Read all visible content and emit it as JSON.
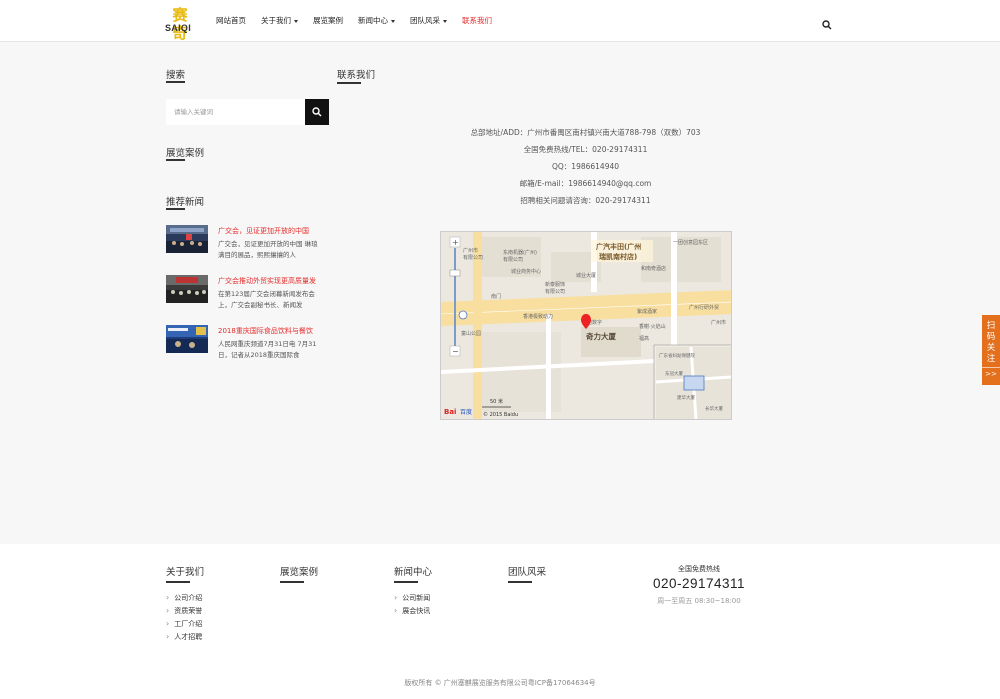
{
  "header": {
    "logo_mark": "赛奇",
    "logo_text": "SAIQI",
    "nav": [
      {
        "label": "网站首页",
        "dropdown": false,
        "active": false
      },
      {
        "label": "关于我们",
        "dropdown": true,
        "active": false
      },
      {
        "label": "展览案例",
        "dropdown": false,
        "active": false
      },
      {
        "label": "新闻中心",
        "dropdown": true,
        "active": false
      },
      {
        "label": "团队风采",
        "dropdown": true,
        "active": false
      },
      {
        "label": "联系我们",
        "dropdown": false,
        "active": true
      }
    ]
  },
  "sidebar": {
    "search_title": "搜索",
    "search_placeholder": "请输入关键词",
    "cases_title": "展览案例",
    "news_title": "推荐新闻",
    "news": [
      {
        "title": "广交会，见证更加开放的中国",
        "desc": "广交会，见证更加开放的中国 琳琅满目的展品，熙熙攘攘的人"
      },
      {
        "title": "广交会推动外贸实现更高质量发",
        "desc": "在第123届广交会闭幕新闻发布会上，广交会副秘书长、新闻发"
      },
      {
        "title": "2018重庆国际食品饮料与餐饮",
        "desc": "人民网重庆频道7月31日电 7月31日，记者从2018重庆国际食"
      }
    ]
  },
  "main": {
    "title": "联系我们",
    "contact": [
      "总部地址/ADD：广州市番禺区南村镇兴南大道788-798（双数）703",
      "全国免费热线/TEL：020-29174311",
      "QQ：1986614940",
      "邮箱/E-mail：1986614940@qq.com",
      "招聘相关问题请咨询：020-29174311"
    ],
    "map": {
      "labels": {
        "poi_main": "广汽丰田(广州",
        "poi_main2": "瑞凯南村店)",
        "building": "奇力大厦",
        "l1": "东南机器(广州)",
        "l2": "有限公司",
        "l3": "一团创意园东区",
        "l4": "城业商务中心",
        "l5": "城业大厦",
        "l6": "和南奇酒店",
        "l7": "南门",
        "l8": "新泰服饰",
        "l9": "有限公司",
        "l10": "广州行研外贸",
        "l11": "香港极致动力",
        "l12": "盈地数字",
        "l13": "紫成酒家",
        "l14": "香榭·火焰山",
        "l15": "福高",
        "l16": "童山公园",
        "l17": "广州市",
        "l18": "有限公司",
        "l19": "广州市",
        "l20": "广东省妇幼保健院",
        "l21": "东冠大厦",
        "l22": "建华大厦",
        "l23": "长华大厦",
        "l24": "有限公司",
        "l25": "有限公司",
        "l26": "有限公司",
        "scale": "50 米",
        "brand": "Bai",
        "brand2": "百度",
        "copyright": "© 2015 Baidu"
      }
    }
  },
  "float_tab": {
    "text": "扫码关注",
    "arrow": ">>"
  },
  "footer": {
    "columns": [
      {
        "title": "关于我们",
        "links": [
          "公司介绍",
          "资质荣誉",
          "工厂介绍",
          "人才招聘"
        ]
      },
      {
        "title": "展览案例",
        "links": []
      },
      {
        "title": "新闻中心",
        "links": [
          "公司新闻",
          "展会快讯"
        ]
      },
      {
        "title": "团队风采",
        "links": []
      }
    ],
    "hotline_label": "全国免费热线",
    "hotline_number": "020-29174311",
    "hotline_hours": "周一至周五 08:30~18:00",
    "copyright": "版权所有 © 广州塞麒展览服务有限公司粤ICP备17064634号"
  },
  "colors": {
    "accent": "#e52b2b",
    "float": "#e4701e"
  }
}
